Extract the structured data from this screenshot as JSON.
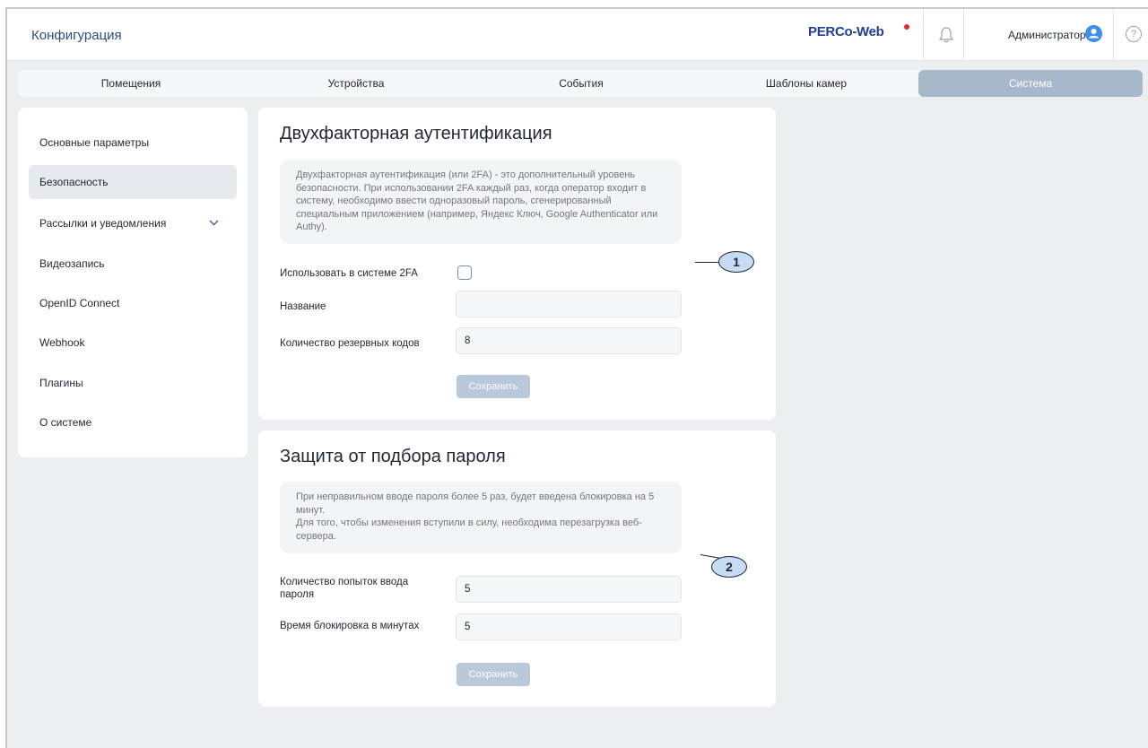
{
  "header": {
    "title": "Конфигурация",
    "logo": "PERCo-Web",
    "user_name": "Администратор",
    "help": "?",
    "icons": [
      "bell-icon",
      "user-avatar-icon",
      "help-icon"
    ]
  },
  "tabs": [
    {
      "label": "Помещения"
    },
    {
      "label": "Устройства"
    },
    {
      "label": "События"
    },
    {
      "label": "Шаблоны камер"
    },
    {
      "label": "Система"
    }
  ],
  "sidebar": {
    "items": [
      {
        "label": "Основные параметры"
      },
      {
        "label": "Безопасность"
      },
      {
        "label": "Рассылки и уведомления"
      },
      {
        "label": "Видеозапись"
      },
      {
        "label": "OpenID Connect"
      },
      {
        "label": "Webhook"
      },
      {
        "label": "Плагины"
      },
      {
        "label": "О системе"
      }
    ]
  },
  "twofa": {
    "title": "Двухфакторная аутентификация",
    "info": "Двухфакторная аутентификация (или 2FA) - это дополнительный уровень безопасности. При использовании 2FA каждый раз, когда оператор входит в систему, необходимо ввести одноразовый пароль, сгенерированный специальным приложением (например, Яндекс Ключ, Google Authenticator или Authy).",
    "use_label": "Использовать в системе 2FA",
    "use_checked": false,
    "name_label": "Название",
    "name_value": "",
    "codes_label": "Количество резервных кодов",
    "codes_value": "8",
    "save_label": "Сохранить"
  },
  "bruteforce": {
    "title": "Защита от подбора пароля",
    "info_line1": "При неправильном вводе пароля более 5 раз, будет введена блокировка на 5 минут.",
    "info_line2": "Для того, чтобы изменения вступили в силу, необходима перезагрузка веб-сервера.",
    "attempts_label": "Количество попыток ввода пароля",
    "attempts_value": "5",
    "lock_label": "Время блокировка в минутах",
    "lock_value": "5",
    "save_label": "Сохранить"
  },
  "callouts": [
    "1",
    "2"
  ],
  "colors": {
    "accent": "#a7b8cc",
    "button_disabled": "#b9c8da",
    "avatar": "#3f8ee8",
    "logo": "#1f3f8f",
    "logo_dot": "#e32b2b",
    "background": "#eceef1"
  }
}
